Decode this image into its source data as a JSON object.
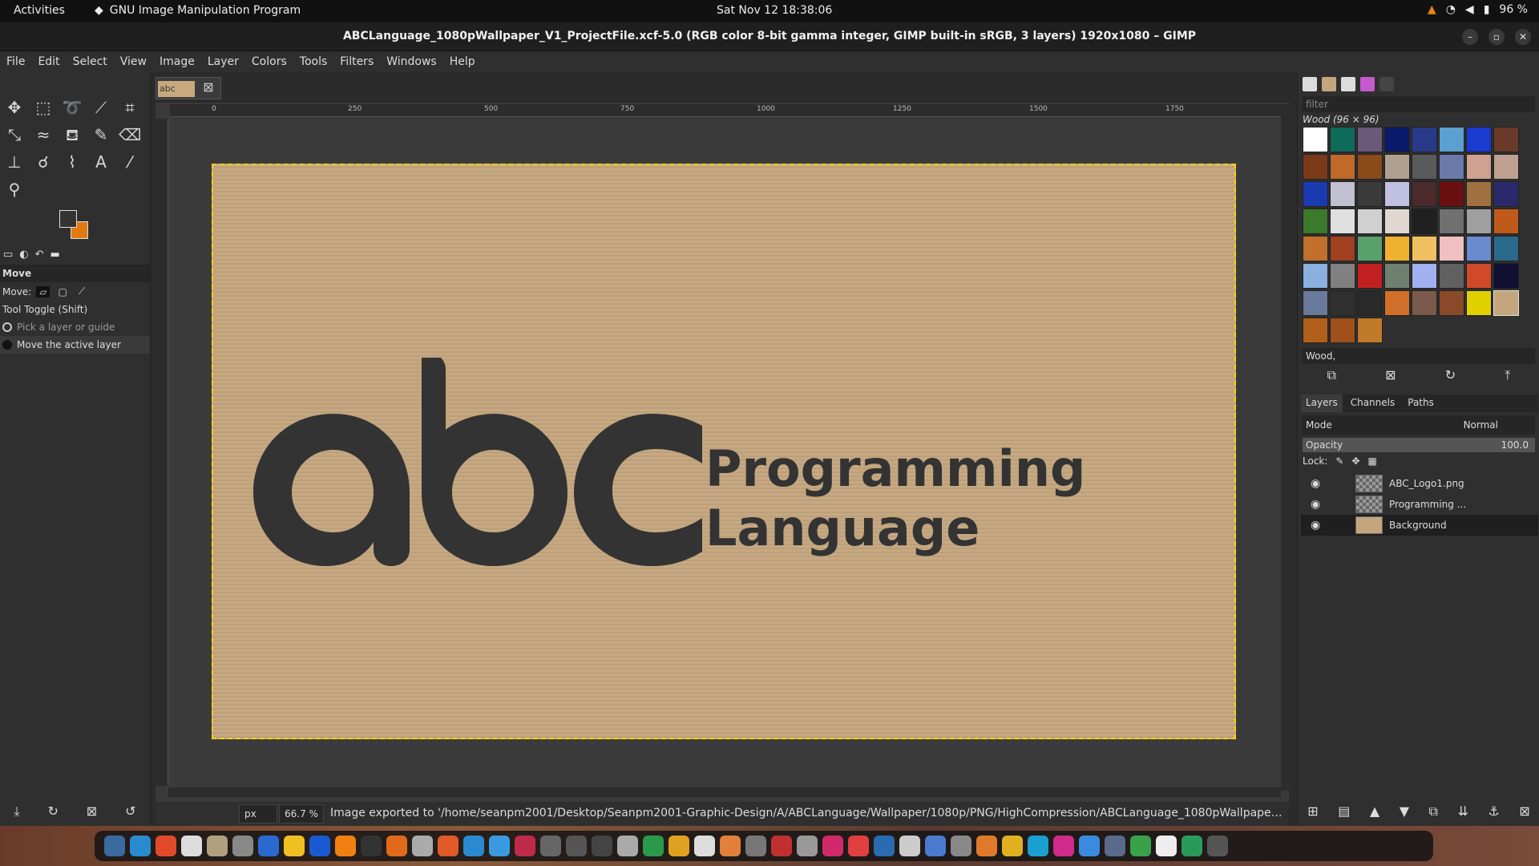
{
  "topbar": {
    "activities": "Activities",
    "app_name": "GNU Image Manipulation Program",
    "clock": "Sat Nov 12  18:38:06",
    "battery": "96 %"
  },
  "window": {
    "title": "ABCLanguage_1080pWallpaper_V1_ProjectFile.xcf-5.0 (RGB color 8-bit gamma integer, GIMP built-in sRGB, 3 layers) 1920x1080 – GIMP"
  },
  "menu": [
    "File",
    "Edit",
    "Select",
    "View",
    "Image",
    "Layer",
    "Colors",
    "Tools",
    "Filters",
    "Windows",
    "Help"
  ],
  "tool_options": {
    "header": "Move",
    "move_label": "Move:",
    "toggle_label": "Tool Toggle  (Shift)",
    "option1": "Pick a layer or guide",
    "option2": "Move the active layer"
  },
  "image_tab": {
    "thumb_text": "abc"
  },
  "ruler": {
    "marks": [
      "0",
      "250",
      "500",
      "750",
      "1000",
      "1250",
      "1500",
      "1750"
    ]
  },
  "canvas": {
    "logo_text": "abc",
    "tagline_line1": "Programming",
    "tagline_line2": "Language",
    "colors": {
      "background": "#c4a67e",
      "logo": "#333333"
    }
  },
  "statusbar": {
    "unit": "px",
    "zoom": "66.7 %",
    "message": "Image exported to '/home/seanpm2001/Desktop/Seanpm2001-Graphic-Design/A/ABCLanguage/Wallpaper/1080p/PNG/HighCompression/ABCLanguage_1080pWallpaper_V1_..."
  },
  "patterns": {
    "filter_placeholder": "filter",
    "title": "Wood (96 × 96)",
    "selected": "Wood,"
  },
  "layers_panel": {
    "tabs": [
      "Layers",
      "Channels",
      "Paths"
    ],
    "mode_label": "Mode",
    "mode_value": "Normal",
    "opacity_label": "Opacity",
    "opacity_value": "100.0",
    "lock_label": "Lock:",
    "layers": [
      {
        "name": "ABC_Logo1.png",
        "thumb": "checker"
      },
      {
        "name": "Programming ...",
        "thumb": "checker"
      },
      {
        "name": "Background",
        "thumb": "wood"
      }
    ]
  }
}
